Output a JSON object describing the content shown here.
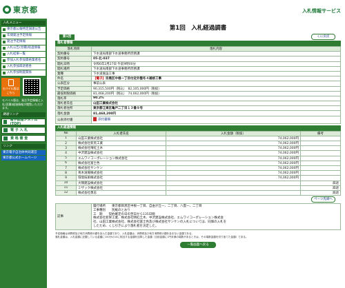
{
  "header": {
    "logo_text": "東京都",
    "service_title": "入札情報サービス"
  },
  "sidebar": {
    "menu_head": "入札メニュー",
    "items": [
      "東京都公報特定調達公告",
      "年間発注予定情報",
      "発注予定情報",
      "入札公告(見積)経過情報",
      "入札結果一覧",
      "参加入札参加資格業者名",
      "入札参加辞退者各",
      "入札参加制度関係"
    ],
    "mobile_label": "モバイル版はこちら",
    "mobile_note": "モバイル版は、発注予定情報と入札(見積)経過情報が閲覧いただけます。",
    "other_head": "関連リンク",
    "buttons": [
      "電子調達システム(TOP)",
      "電 子 入 札",
      "資 格 審 査"
    ],
    "links_head": "リンク",
    "links": [
      "東京電子自治体共同運営",
      "東京都公式ホームページ"
    ]
  },
  "main": {
    "page_title": "第1回　入札経過調書",
    "page_tag": "第1回",
    "back_label": "くに戻戻",
    "info_bar": "落札者情報",
    "info_headers": [
      "落札項目",
      "落札内容"
    ],
    "info_rows": [
      {
        "k": "契約番号",
        "v": "下水道局南部下水道事務所庶務課"
      },
      {
        "k": "契約番号",
        "v": "05-北-037"
      },
      {
        "k": "開札日時",
        "v": "令和6年2月27日 午前9時00分"
      },
      {
        "k": "開札場所",
        "v": "下水道局南部下水道事務所庶務課"
      },
      {
        "k": "業種",
        "v": "下水道施設工事"
      },
      {
        "k": "件名",
        "v": "目黒区中根一丁目付近外整冬４補修工事",
        "tag": "【電子】"
      },
      {
        "k": "公表区分",
        "v": "事前公表"
      },
      {
        "k": "予定価格",
        "v": "90,315,500円（税込）　82,105,000円（税抜）"
      },
      {
        "k": "最低制限価格",
        "v": "81,468,200円（税込）　74,062,000円（税抜）"
      },
      {
        "k": "落札率",
        "v": "90.2%"
      },
      {
        "k": "落札者氏名",
        "v": "山田工業株式会社"
      },
      {
        "k": "落札者住所",
        "v": "東京都江東区亀戸二丁目１３番９号"
      },
      {
        "k": "落札金額",
        "v": "81,468,200円"
      },
      {
        "k": "公表添付書",
        "v": "添付書類"
      }
    ],
    "bid_bar": "入札経過情報",
    "bid_headers": [
      "No",
      "入札者氏名",
      "入札金額（税抜）",
      "備考"
    ],
    "bids": [
      {
        "no": "1",
        "name": "山田工業株式会社",
        "amt": "74,062,000円",
        "ex": ""
      },
      {
        "no": "2",
        "name": "株式会社新英工業",
        "amt": "74,062,000円",
        "ex": ""
      },
      {
        "no": "3",
        "name": "株式会社晴紅土木",
        "amt": "74,062,000円",
        "ex": ""
      },
      {
        "no": "4",
        "name": "中沢建設株式会社",
        "amt": "74,062,000円",
        "ex": ""
      },
      {
        "no": "5",
        "name": "エムワイコーポレーション株式会社",
        "amt": "74,062,000円",
        "ex": ""
      },
      {
        "no": "6",
        "name": "株式会社富士色",
        "amt": "74,062,000円",
        "ex": ""
      },
      {
        "no": "7",
        "name": "株式会社サンケン",
        "amt": "74,062,000円",
        "ex": ""
      },
      {
        "no": "8",
        "name": "青木滝場株式会社",
        "amt": "74,062,000円",
        "ex": ""
      },
      {
        "no": "9",
        "name": "環境技術株式会社",
        "amt": "74,062,000円",
        "ex": ""
      },
      {
        "no": "10",
        "name": "大隅建設株式会社",
        "amt": "",
        "ex": "辞退"
      },
      {
        "no": "11",
        "name": "ミザック株式会社",
        "amt": "",
        "ex": "辞退"
      },
      {
        "no": "12",
        "name": "株式会社勇志",
        "amt": "",
        "ex": "辞退"
      }
    ],
    "next_label": "ページ先頭へ",
    "note_label": "記事",
    "note_lines": [
      "履行場所　　東京都目黒区中根一丁目、自由が丘一、二丁目、八雲一、二丁目",
      "工事種別　　別紙のとおり",
      "工　期　　契約確定の日の翌日から135日間",
      "株式会社新栄工業、株式会社晴紅土木、中沢建設株式会社、エムワイコーポレーション株式会",
      "社、山田工業株式会社、株式会社富士色及び株式会社サンケンの入札については、同価の入札を",
      "したため、くじ引きにより落札者を決定した。"
    ],
    "footnote": [
      "予定価格は消費税及び地方消費税の額を含んだ金額であり、入札金額は、消費税及び地方消費税の額を含まない金額である。",
      "落札金額は、入札金額に記載している金額に100分の10に相当する金額を加算した金額（当該金額に1円未満の端数があるときは、その端数金額を切り捨てた金額）である。"
    ],
    "bottom_label": "一覧画面へ戻る"
  }
}
